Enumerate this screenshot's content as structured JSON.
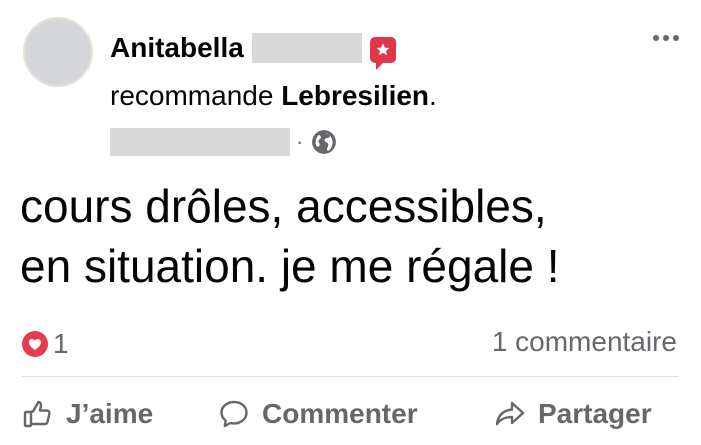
{
  "post": {
    "author": "Anitabella",
    "recommend_prefix": "recommande",
    "recommend_page": "Lebresilien",
    "recommend_suffix": ".",
    "meta_separator": "·",
    "text_line1": "cours drôles, accessibles,",
    "text_line2": "en situation. je me régale !"
  },
  "stats": {
    "reaction_count": "1",
    "comments": "1 commentaire"
  },
  "actions": {
    "like": "J’aime",
    "comment": "Commenter",
    "share": "Partager"
  },
  "colors": {
    "badge": "#e0364c",
    "heart": "#e53c4f",
    "secondary_text": "#65676b"
  },
  "icons": [
    "recommendation-badge-icon",
    "more-options-icon",
    "globe-icon",
    "heart-reaction-icon",
    "like-icon",
    "comment-icon",
    "share-icon"
  ]
}
